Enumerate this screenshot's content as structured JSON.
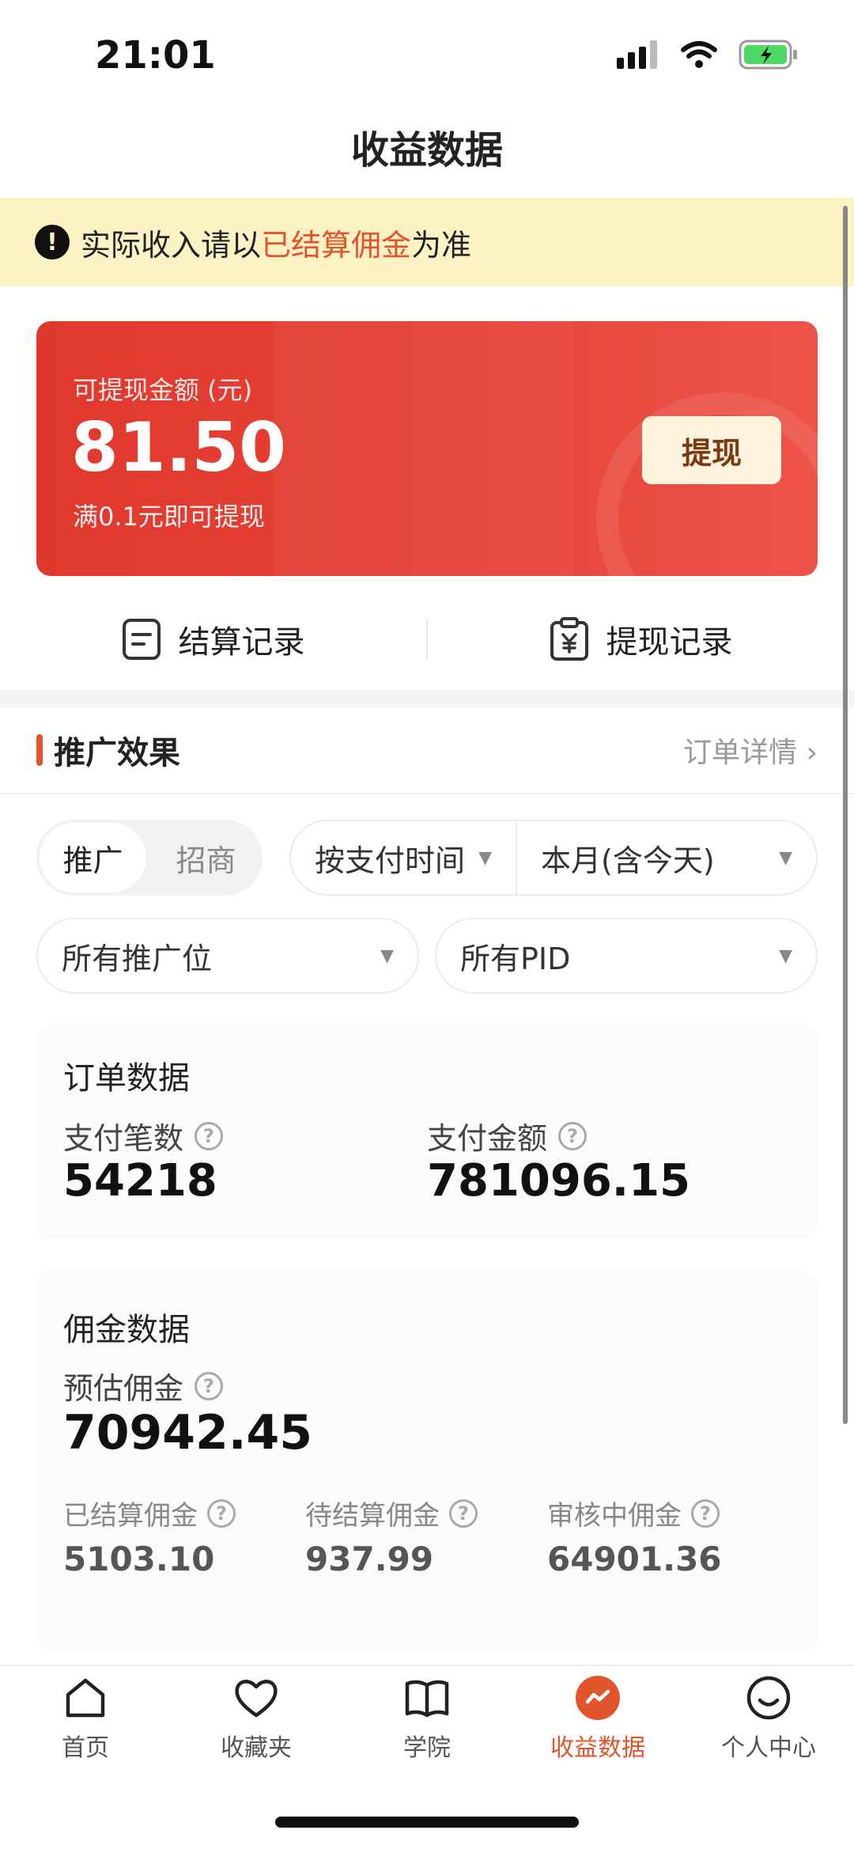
{
  "status_bar": {
    "time": "21:01"
  },
  "nav": {
    "title": "收益数据"
  },
  "notice": {
    "prefix": "实际收入请以",
    "highlight": "已结算佣金",
    "suffix": "为准"
  },
  "balance": {
    "label": "可提现金额 (元)",
    "amount": "81.50",
    "hint": "满0.1元即可提现",
    "withdraw_label": "提现"
  },
  "records": {
    "settlement_label": "结算记录",
    "withdraw_label": "提现记录"
  },
  "promo": {
    "title": "推广效果",
    "order_detail": "订单详情 ›",
    "segments": [
      "推广",
      "招商"
    ],
    "filters": {
      "pay_time": "按支付时间",
      "period": "本月(含今天)",
      "position": "所有推广位",
      "pid": "所有PID"
    }
  },
  "order_data": {
    "title": "订单数据",
    "pay_count_label": "支付笔数",
    "pay_count": "54218",
    "pay_amount_label": "支付金额",
    "pay_amount": "781096.15"
  },
  "commission": {
    "title": "佣金数据",
    "estimated_label": "预估佣金",
    "estimated": "70942.45",
    "settled_label": "已结算佣金",
    "settled": "5103.10",
    "pending_label": "待结算佣金",
    "pending": "937.99",
    "review_label": "审核中佣金",
    "review": "64901.36"
  },
  "tabbar": {
    "items": [
      {
        "label": "首页",
        "icon": "home-icon"
      },
      {
        "label": "收藏夹",
        "icon": "heart-icon"
      },
      {
        "label": "学院",
        "icon": "book-icon"
      },
      {
        "label": "收益数据",
        "icon": "earnings-icon"
      },
      {
        "label": "个人中心",
        "icon": "profile-icon"
      }
    ]
  },
  "colors": {
    "accent": "#e2542c",
    "card_red": "#e0382c",
    "notice_bg": "#fdf2c4"
  }
}
